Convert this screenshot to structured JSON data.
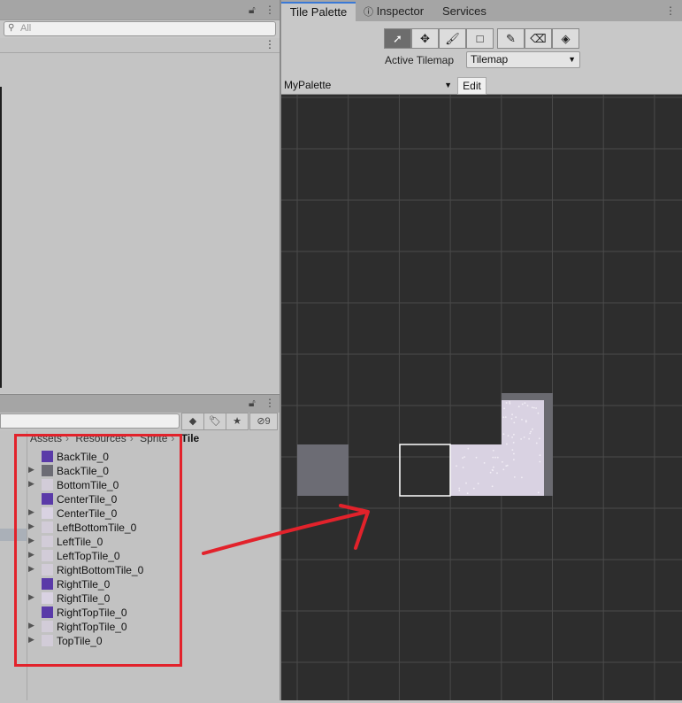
{
  "left_top": {
    "search_placeholder": "All",
    "lock_icon": "lock-icon",
    "menu_icon": "kebab-menu-icon"
  },
  "left_bottom": {
    "hidden_count": "9",
    "breadcrumb": [
      "Assets",
      "Resources",
      "Sprite",
      "Tile"
    ],
    "assets": [
      {
        "name": "BackTile_0",
        "expandable": false,
        "thumb": "#5a3aa8"
      },
      {
        "name": "BackTile_0",
        "expandable": true,
        "thumb": "#6c6c74"
      },
      {
        "name": "BottomTile_0",
        "expandable": true,
        "thumb": "#d2ccd8"
      },
      {
        "name": "CenterTile_0",
        "expandable": false,
        "thumb": "#5a3aa8"
      },
      {
        "name": "CenterTile_0",
        "expandable": true,
        "thumb": "#d9d2e2"
      },
      {
        "name": "LeftBottomTile_0",
        "expandable": true,
        "thumb": "#d2ccd8"
      },
      {
        "name": "LeftTile_0",
        "expandable": true,
        "thumb": "#d2ccd8"
      },
      {
        "name": "LeftTopTile_0",
        "expandable": true,
        "thumb": "#d2ccd8"
      },
      {
        "name": "RightBottomTile_0",
        "expandable": true,
        "thumb": "#d2ccd8"
      },
      {
        "name": "RightTile_0",
        "expandable": false,
        "thumb": "#5a3aa8"
      },
      {
        "name": "RightTile_0",
        "expandable": true,
        "thumb": "#d9d2e2"
      },
      {
        "name": "RightTopTile_0",
        "expandable": false,
        "thumb": "#5a3aa8"
      },
      {
        "name": "RightTopTile_0",
        "expandable": true,
        "thumb": "#d2ccd8"
      },
      {
        "name": "TopTile_0",
        "expandable": true,
        "thumb": "#d2ccd8"
      }
    ]
  },
  "right": {
    "tabs": [
      "Tile Palette",
      "Inspector",
      "Services"
    ],
    "active_tilemap_label": "Active Tilemap",
    "active_tilemap_value": "Tilemap",
    "palette_name": "MyPalette",
    "edit_label": "Edit",
    "tools": [
      "select-tool-icon",
      "move-tool-icon",
      "paint-brush-icon",
      "box-fill-icon",
      "picker-icon",
      "eraser-icon",
      "fill-bucket-icon"
    ]
  },
  "colors": {
    "accent_tab": "#3a79d6",
    "annotation_red": "#e2222b",
    "grid_bg": "#2d2d2d",
    "tile_light": "#d9d2e2",
    "tile_gray": "#6c6c74"
  }
}
